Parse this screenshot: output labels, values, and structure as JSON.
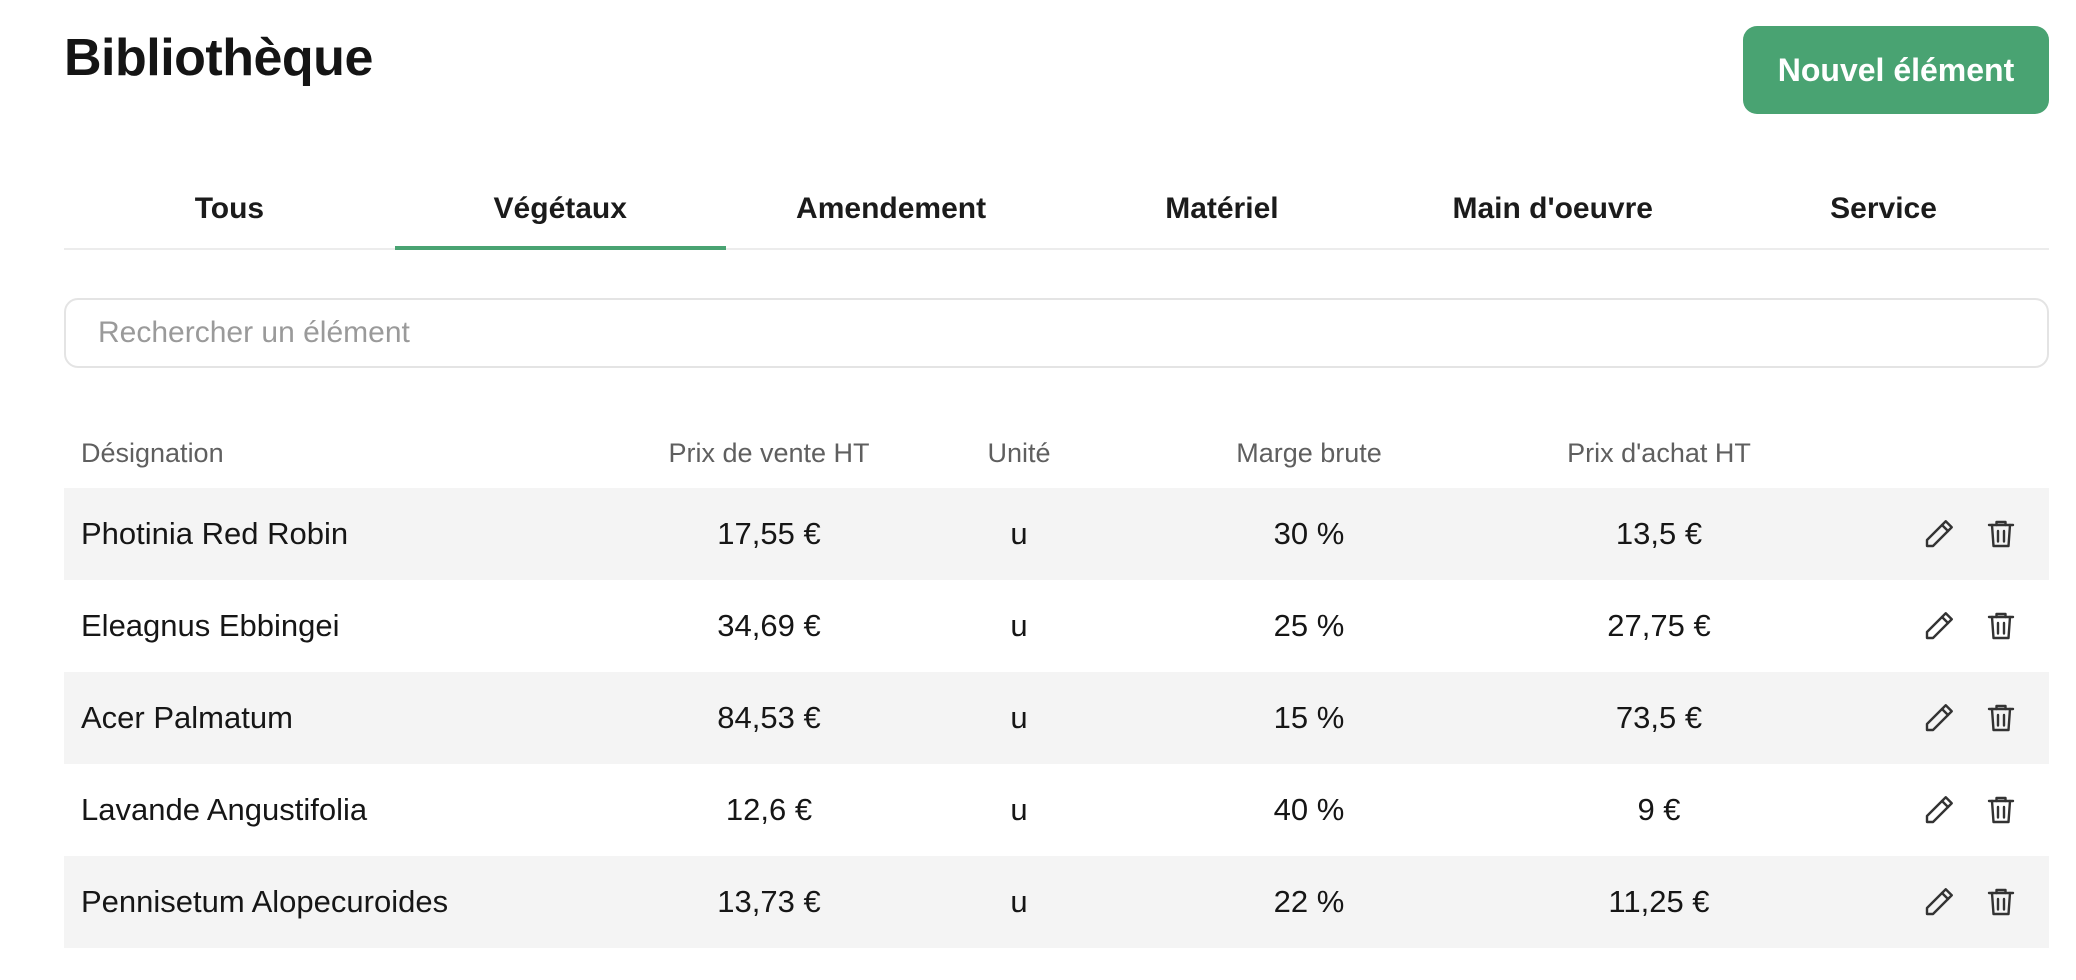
{
  "header": {
    "title": "Bibliothèque",
    "new_button_label": "Nouvel élément"
  },
  "tabs": [
    {
      "label": "Tous",
      "active": false
    },
    {
      "label": "Végétaux",
      "active": true
    },
    {
      "label": "Amendement",
      "active": false
    },
    {
      "label": "Matériel",
      "active": false
    },
    {
      "label": "Main d'oeuvre",
      "active": false
    },
    {
      "label": "Service",
      "active": false
    }
  ],
  "search": {
    "placeholder": "Rechercher un élément",
    "value": ""
  },
  "table": {
    "columns": [
      "Désignation",
      "Prix de vente HT",
      "Unité",
      "Marge brute",
      "Prix d'achat HT"
    ],
    "rows": [
      {
        "designation": "Photinia Red Robin",
        "sale_price": "17,55 €",
        "unit": "u",
        "margin": "30 %",
        "purchase_price": "13,5 €"
      },
      {
        "designation": "Eleagnus Ebbingei",
        "sale_price": "34,69 €",
        "unit": "u",
        "margin": "25 %",
        "purchase_price": "27,75 €"
      },
      {
        "designation": "Acer Palmatum",
        "sale_price": "84,53 €",
        "unit": "u",
        "margin": "15 %",
        "purchase_price": "73,5 €"
      },
      {
        "designation": "Lavande Angustifolia",
        "sale_price": "12,6 €",
        "unit": "u",
        "margin": "40 %",
        "purchase_price": "9 €"
      },
      {
        "designation": "Pennisetum Alopecuroides",
        "sale_price": "13,73 €",
        "unit": "u",
        "margin": "22 %",
        "purchase_price": "11,25 €"
      }
    ],
    "row_actions": [
      "pencil-icon",
      "trash-icon"
    ]
  },
  "colors": {
    "accent": "#49a372",
    "row_alt_background": "#f4f4f4",
    "text": "#161616",
    "muted_text": "#5f5f5f"
  }
}
